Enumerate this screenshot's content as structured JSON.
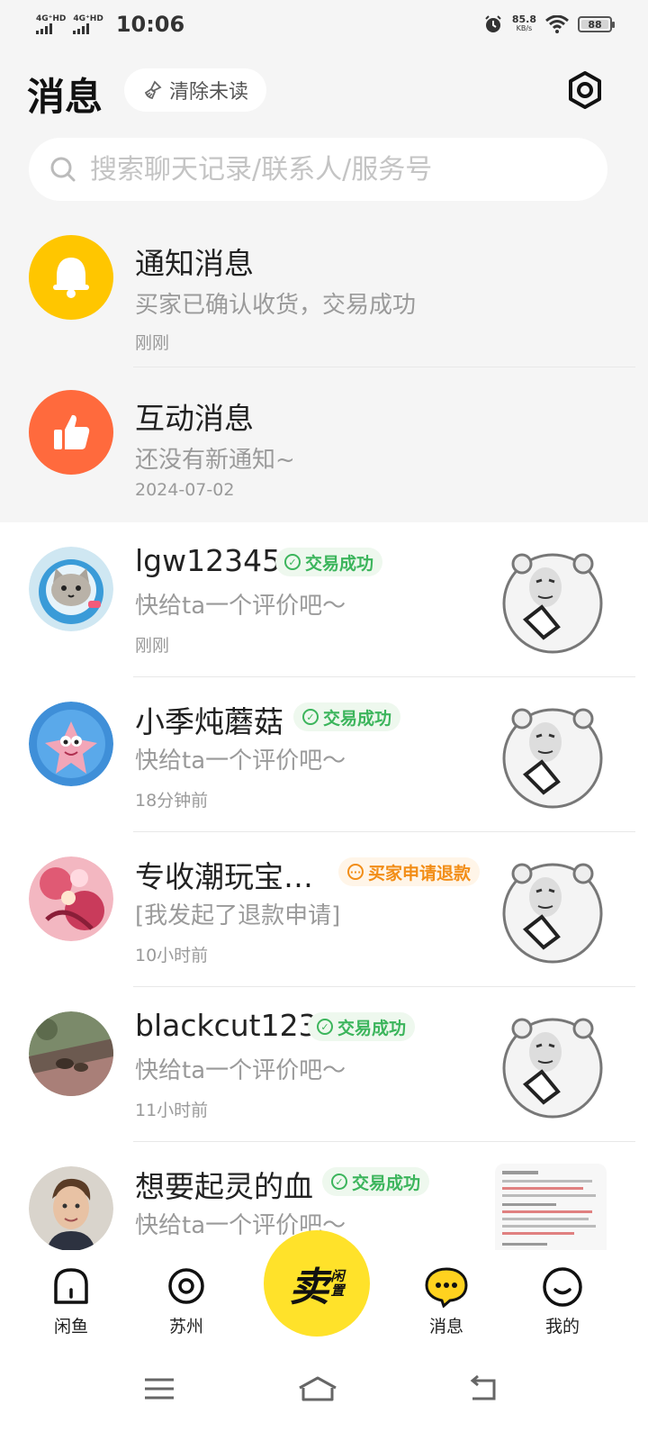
{
  "status_bar": {
    "network1": "4G⁺HD",
    "network2": "4G⁺HD",
    "time": "10:06",
    "speed_value": "85.8",
    "speed_unit": "KB/s",
    "battery": "88"
  },
  "header": {
    "title": "消息",
    "clear_unread_label": "清除未读"
  },
  "search": {
    "placeholder": "搜索聊天记录/联系人/服务号"
  },
  "system_rows": [
    {
      "title": "通知消息",
      "subtitle": "买家已确认收货，交易成功",
      "time": "刚刚",
      "icon": "bell-icon",
      "color": "#ffc600"
    },
    {
      "title": "互动消息",
      "subtitle": "还没有新通知~",
      "time": "2024-07-02",
      "icon": "thumbs-up-icon",
      "color": "#ff6a3d"
    }
  ],
  "chats": [
    {
      "name": "lgw12345",
      "badge": "交易成功",
      "badge_type": "ok",
      "message": "快给ta一个评价吧～",
      "time": "刚刚"
    },
    {
      "name": "小季炖蘑菇",
      "badge": "交易成功",
      "badge_type": "ok",
      "message": "快给ta一个评价吧～",
      "time": "18分钟前"
    },
    {
      "name": "专收潮玩宝…",
      "badge": "买家申请退款",
      "badge_type": "warn",
      "message": "[我发起了退款申请]",
      "time": "10小时前"
    },
    {
      "name": "blackcut123",
      "badge": "交易成功",
      "badge_type": "ok",
      "message": "快给ta一个评价吧～",
      "time": "11小时前"
    },
    {
      "name": "想要起灵的血",
      "badge": "交易成功",
      "badge_type": "ok",
      "message": "快给ta一个评价吧～",
      "time": ""
    }
  ],
  "bottom_nav": {
    "home": "闲鱼",
    "city": "苏州",
    "sell_main": "卖",
    "sell_small_1": "闲",
    "sell_small_2": "置",
    "messages": "消息",
    "mine": "我的"
  },
  "colors": {
    "accent": "#ffe22a",
    "success": "#3cb55c",
    "warning": "#f28d16"
  }
}
